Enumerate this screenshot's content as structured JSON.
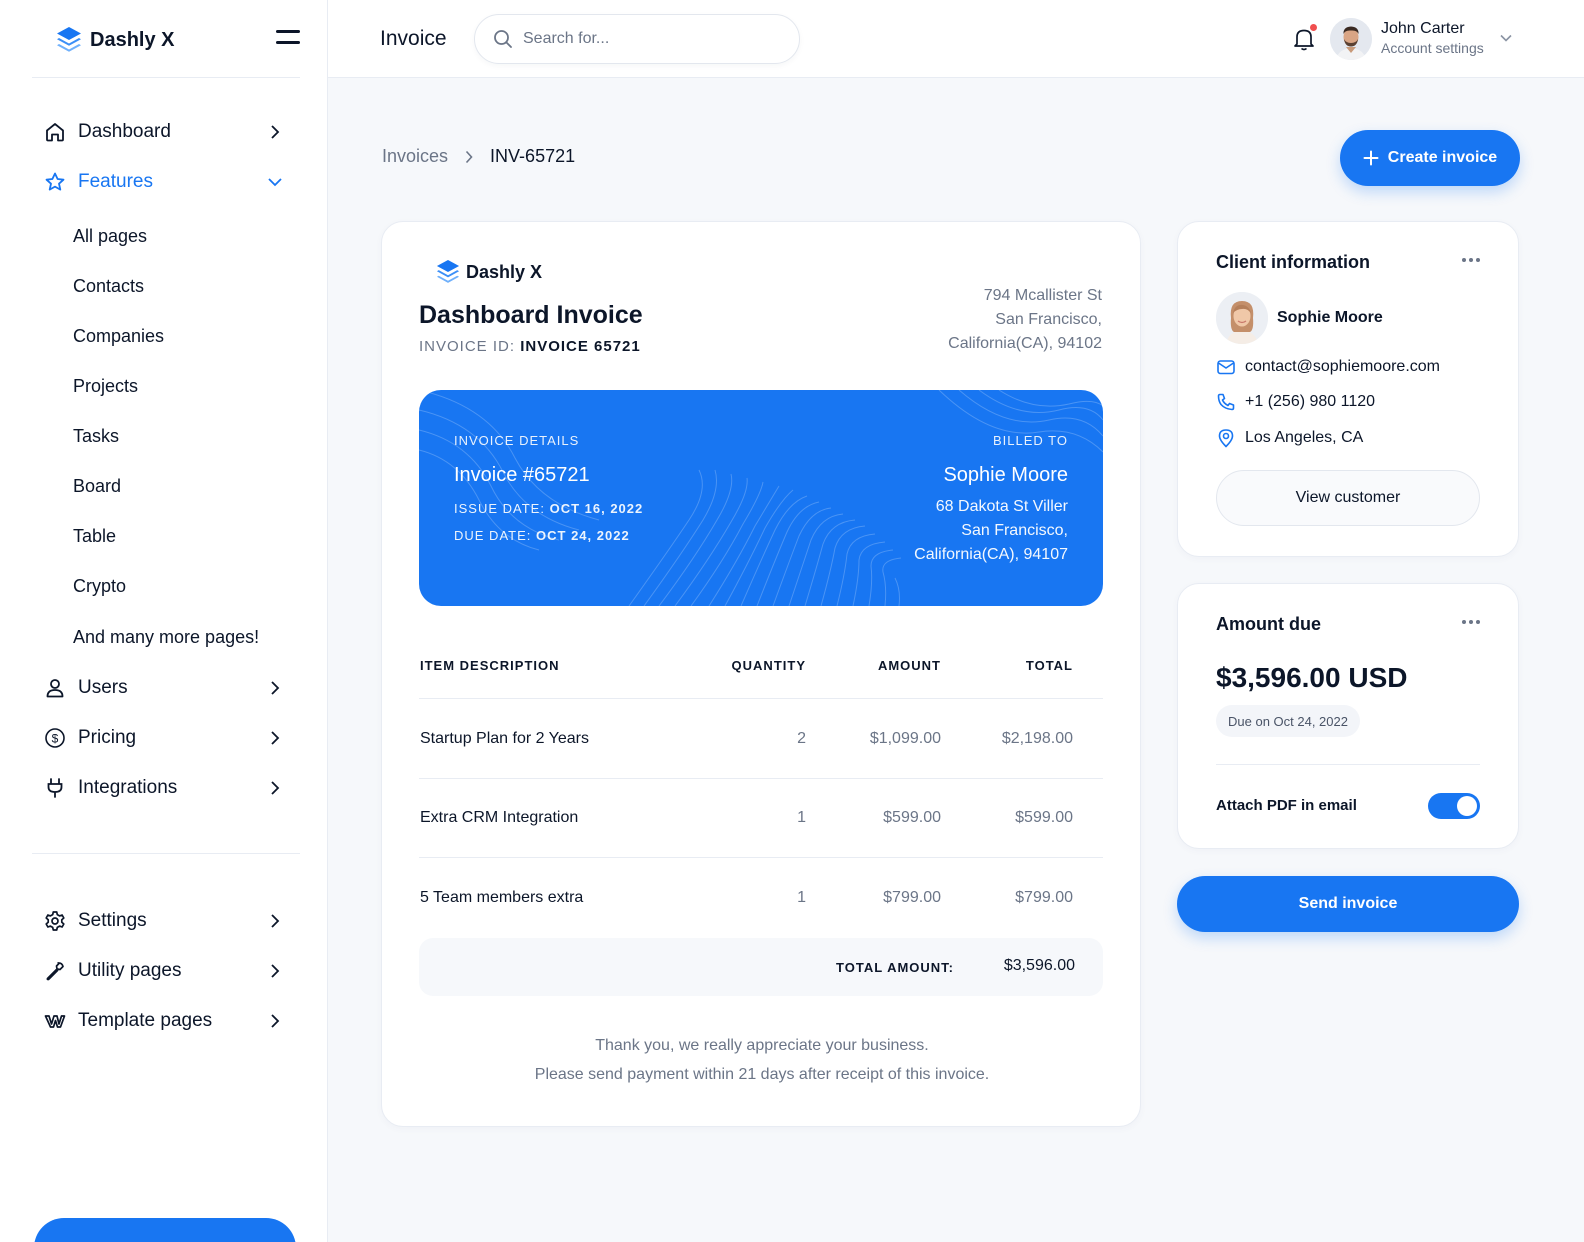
{
  "sidebar": {
    "brand": "Dashly X",
    "nav": [
      {
        "label": "Dashboard",
        "icon": "home-icon"
      },
      {
        "label": "Features",
        "icon": "star-icon",
        "active": true
      }
    ],
    "sub_items": [
      "All pages",
      "Contacts",
      "Companies",
      "Projects",
      "Tasks",
      "Board",
      "Table",
      "Crypto",
      "And many more pages!"
    ],
    "nav2": [
      {
        "label": "Users",
        "icon": "user-icon"
      },
      {
        "label": "Pricing",
        "icon": "dollar-icon"
      },
      {
        "label": "Integrations",
        "icon": "plug-icon"
      }
    ],
    "nav3": [
      {
        "label": "Settings",
        "icon": "gear-icon"
      },
      {
        "label": "Utility pages",
        "icon": "wrench-icon"
      },
      {
        "label": "Template pages",
        "icon": "webflow-icon"
      }
    ]
  },
  "topbar": {
    "title": "Invoice",
    "search_placeholder": "Search for...",
    "user_name": "John Carter",
    "user_sub": "Account settings"
  },
  "breadcrumb": {
    "parent": "Invoices",
    "current": "INV-65721"
  },
  "create_button": "Create invoice",
  "invoice": {
    "brand": "Dashly X",
    "title": "Dashboard Invoice",
    "id_label": "INVOICE ID:",
    "id_value": "INVOICE 65721",
    "address": [
      "794 Mcallister St",
      "San Francisco,",
      "California(CA), 94102"
    ],
    "details_label": "INVOICE DETAILS",
    "number": "Invoice #65721",
    "issue_label": "ISSUE DATE:",
    "issue_value": "OCT 16, 2022",
    "due_label": "DUE DATE:",
    "due_value": "OCT 24, 2022",
    "billed_label": "BILLED TO",
    "billed_name": "Sophie Moore",
    "billed_address": [
      "68 Dakota St Viller",
      "San Francisco,",
      "California(CA), 94107"
    ],
    "columns": [
      "ITEM DESCRIPTION",
      "QUANTITY",
      "AMOUNT",
      "TOTAL"
    ],
    "rows": [
      {
        "desc": "Startup Plan for 2 Years",
        "qty": "2",
        "amount": "$1,099.00",
        "total": "$2,198.00"
      },
      {
        "desc": "Extra CRM Integration",
        "qty": "1",
        "amount": "$599.00",
        "total": "$599.00"
      },
      {
        "desc": "5 Team members extra",
        "qty": "1",
        "amount": "$799.00",
        "total": "$799.00"
      }
    ],
    "total_label": "TOTAL AMOUNT:",
    "total_value": "$3,596.00",
    "thanks_1": "Thank you, we really appreciate your business.",
    "thanks_2": "Please send payment within 21 days after receipt of this invoice."
  },
  "client": {
    "title": "Client information",
    "name": "Sophie Moore",
    "email": "contact@sophiemoore.com",
    "phone": "+1 (256) 980 1120",
    "location": "Los Angeles, CA",
    "view_button": "View customer"
  },
  "amount": {
    "title": "Amount due",
    "value": "$3,596.00 USD",
    "due": "Due on Oct 24, 2022",
    "attach_label": "Attach PDF in email",
    "attach_enabled": true
  },
  "send_button": "Send invoice",
  "colors": {
    "accent": "#1876f2",
    "text": "#0c1629",
    "muted": "#6b7587"
  }
}
